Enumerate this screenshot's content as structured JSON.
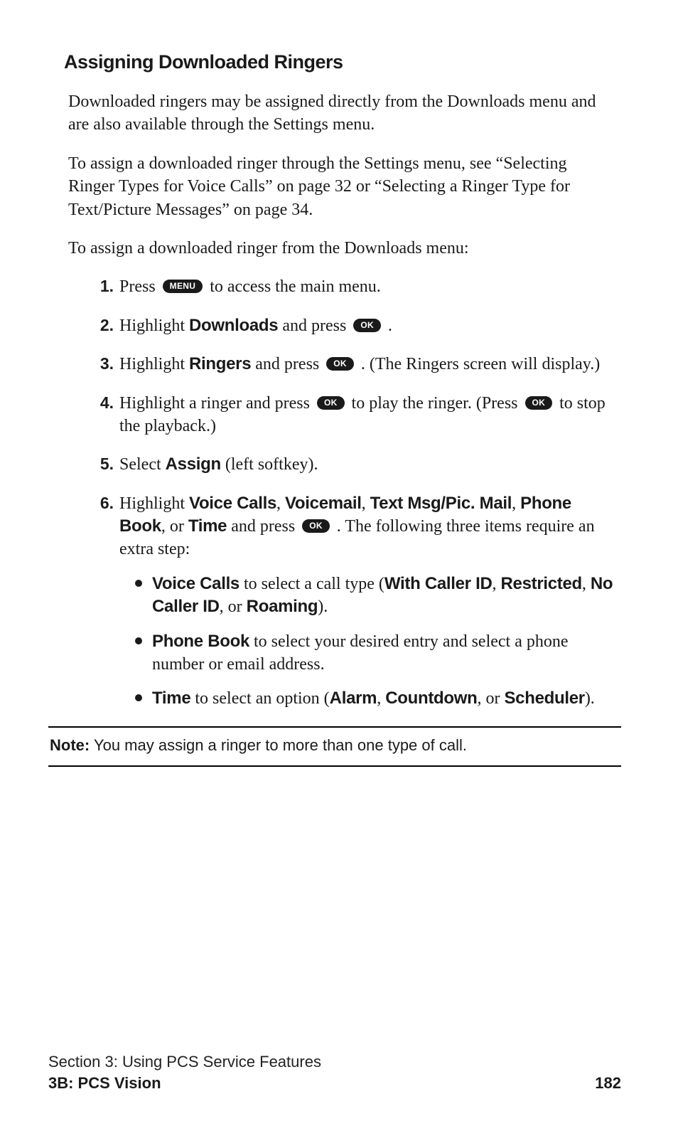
{
  "heading": "Assigning Downloaded Ringers",
  "para1": "Downloaded ringers may be assigned directly from the Downloads menu and are also available through the Settings menu.",
  "para2": "To assign a downloaded ringer through the Settings menu, see “Selecting Ringer Types for Voice Calls” on page 32 or “Selecting a Ringer Type for Text/Picture Messages” on page 34.",
  "para3": "To assign a downloaded ringer from the Downloads menu:",
  "buttons": {
    "menu": "MENU",
    "ok": "OK"
  },
  "steps": {
    "s1": {
      "num": "1.",
      "a": "Press ",
      "b": " to access the main menu."
    },
    "s2": {
      "num": "2.",
      "a": "Highlight ",
      "b": "Downloads",
      "c": " and press ",
      "d": " ."
    },
    "s3": {
      "num": "3.",
      "a": "Highlight ",
      "b": "Ringers",
      "c": " and press ",
      "d": " . (The Ringers screen will display.)"
    },
    "s4": {
      "num": "4.",
      "a": "Highlight a ringer and press ",
      "b": " to play the ringer. (Press ",
      "c": " to stop the playback.)"
    },
    "s5": {
      "num": "5.",
      "a": "Select ",
      "b": "Assign",
      "c": " (left softkey)."
    },
    "s6": {
      "num": "6.",
      "a": "Highlight ",
      "b": "Voice Calls",
      "c": ", ",
      "d": "Voicemail",
      "e": ", ",
      "f": "Text Msg/Pic. Mail",
      "g": ", ",
      "h": "Phone Book",
      "i": ", or ",
      "j": "Time",
      "k": " and press ",
      "l": " . The following three items require an extra step:"
    }
  },
  "bullets": {
    "b1": {
      "a": "Voice Calls",
      "b": " to select a call type (",
      "c": "With Caller ID",
      "d": ", ",
      "e": "Restricted",
      "f": ", ",
      "g": "No Caller ID",
      "h": ", or ",
      "i": "Roaming",
      "j": ")."
    },
    "b2": {
      "a": "Phone Book",
      "b": " to select your desired entry and select a phone number or email address."
    },
    "b3": {
      "a": "Time",
      "b": " to select an option (",
      "c": "Alarm",
      "d": ", ",
      "e": "Countdown",
      "f": ", or ",
      "g": "Scheduler",
      "h": ")."
    }
  },
  "note": {
    "label": "Note:",
    "text": " You may assign a ringer to more than one type of call."
  },
  "footer": {
    "section": "Section 3: Using PCS Service Features",
    "sub": "3B: PCS Vision",
    "page": "182"
  }
}
